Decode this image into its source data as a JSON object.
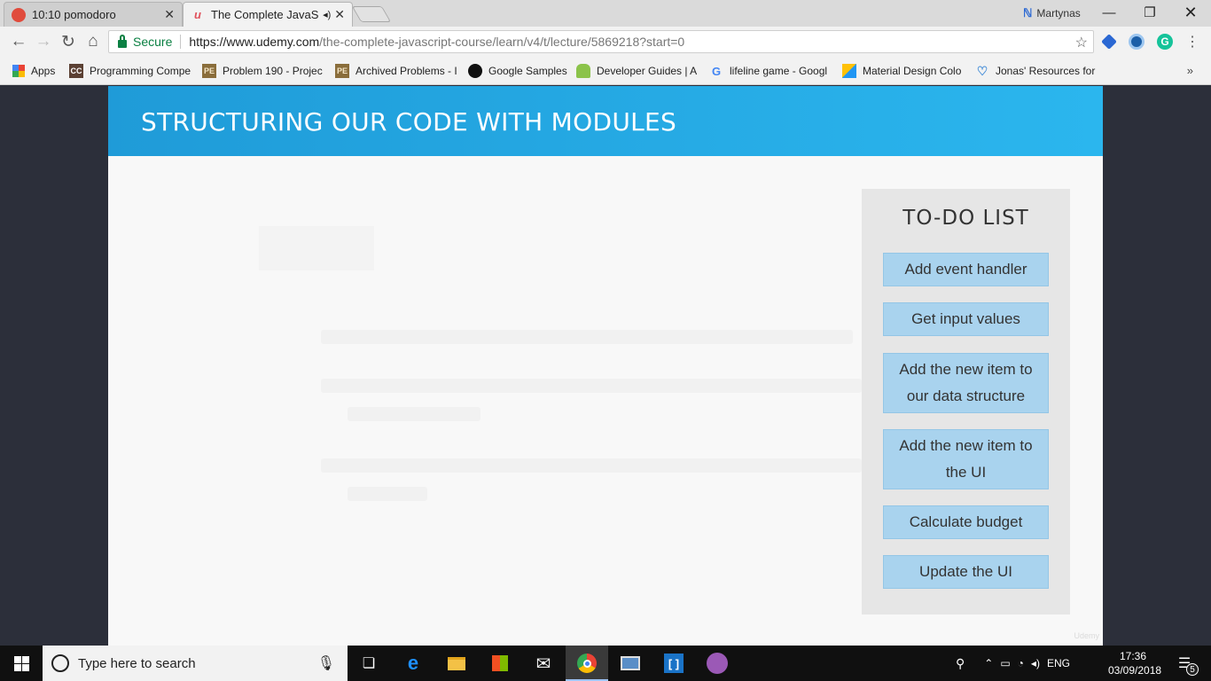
{
  "browser": {
    "tabs": [
      {
        "title": "10:10 pomodoro",
        "active": false
      },
      {
        "title": "The Complete JavaScr",
        "active": true
      }
    ],
    "profile_name": "Martynas",
    "address": {
      "secure_label": "Secure",
      "url_host": "https://www.udemy.com",
      "url_path": "/the-complete-javascript-course/learn/v4/t/lecture/5869218?start=0"
    },
    "bookmarks": [
      "Apps",
      "Programming Compe",
      "Problem 190 - Projec",
      "Archived Problems - I",
      "Google Samples",
      "Developer Guides | A",
      "lifeline game - Googl",
      "Material Design Colo",
      "Jonas' Resources for E"
    ],
    "bookmarks_more": "»"
  },
  "slide": {
    "title": "STRUCTURING OUR CODE WITH MODULES",
    "todo": {
      "title": "TO-DO LIST",
      "items": [
        "Add event handler",
        "Get input values",
        "Add the new item to our data structure",
        "Add the new item to the UI",
        "Calculate budget",
        "Update the UI"
      ]
    },
    "watermark": "Udemy"
  },
  "taskbar": {
    "search_placeholder": "Type here to search",
    "language": "ENG",
    "time": "17:36",
    "date": "03/09/2018",
    "notification_count": "5"
  },
  "colors": {
    "header_blue": "#2bb6ee",
    "todo_item": "#a9d3ee",
    "page_bg": "#2c2f3a"
  }
}
